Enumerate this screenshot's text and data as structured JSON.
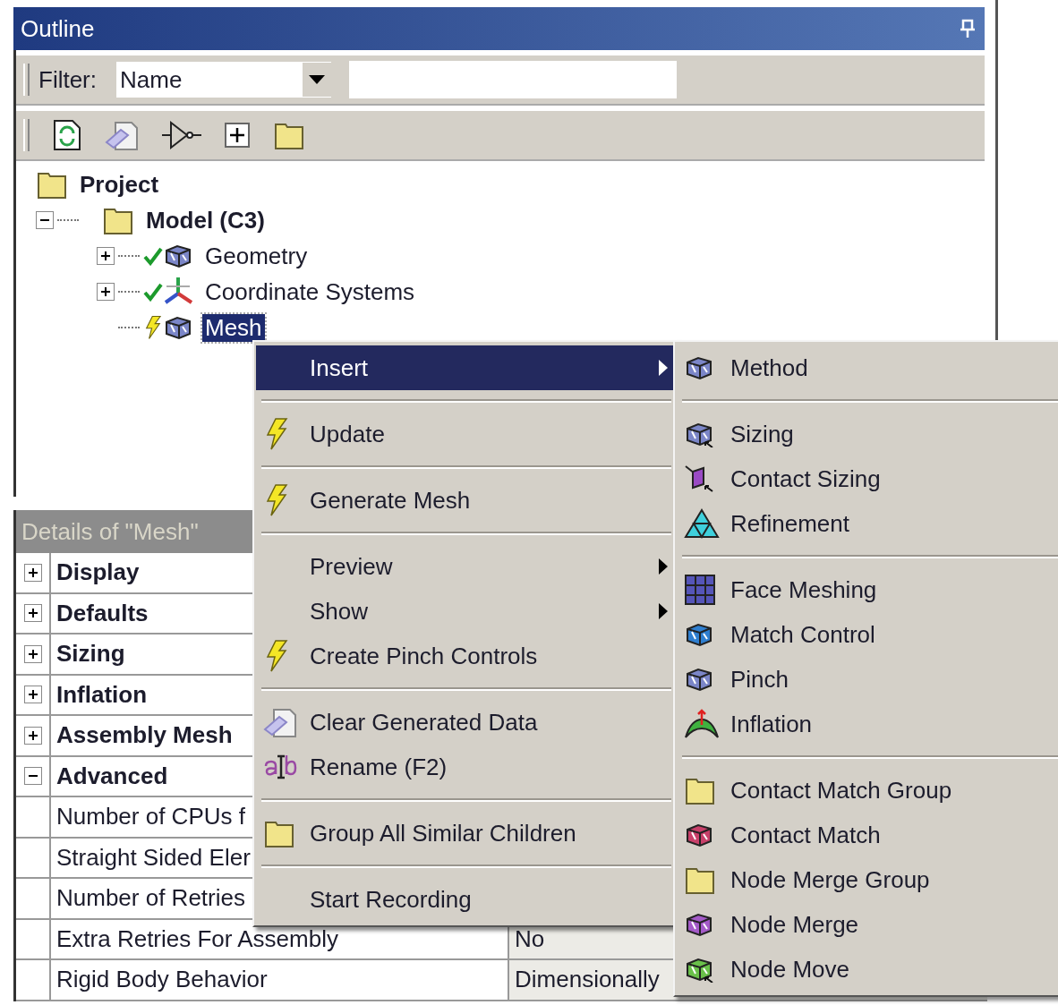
{
  "outline": {
    "title": "Outline",
    "filter": {
      "label": "Filter:",
      "value": "Name"
    },
    "tree": [
      {
        "label": "Project",
        "bold": true,
        "selected": false,
        "children": [
          {
            "label": "Model (C3)",
            "bold": true,
            "selected": false,
            "expanded": true,
            "children": [
              {
                "label": "Geometry",
                "bold": false,
                "selected": false,
                "expanded": false,
                "outdated": false
              },
              {
                "label": "Coordinate Systems",
                "bold": false,
                "selected": false,
                "expanded": false,
                "outdated": false
              },
              {
                "label": "Mesh",
                "bold": false,
                "selected": true,
                "outdated": true
              }
            ]
          }
        ]
      }
    ]
  },
  "details": {
    "title": "Details of \"Mesh\"",
    "groups": [
      {
        "label": "Display",
        "expanded": false
      },
      {
        "label": "Defaults",
        "expanded": false
      },
      {
        "label": "Sizing",
        "expanded": false
      },
      {
        "label": "Inflation",
        "expanded": false
      },
      {
        "label": "Assembly Mesh",
        "expanded": false
      },
      {
        "label": "Advanced",
        "expanded": true,
        "children": [
          {
            "name": "Number of CPUs f"
          },
          {
            "name": "Straight Sided Eler"
          },
          {
            "name": "Number of Retries"
          },
          {
            "name": "Extra Retries For Assembly",
            "value": "No"
          },
          {
            "name": "Rigid Body Behavior",
            "value": "Dimensionally"
          }
        ]
      }
    ]
  },
  "context_menu": {
    "sections": [
      [
        {
          "label": "Insert",
          "submenu": true,
          "selected": true
        }
      ],
      [
        {
          "label": "Update",
          "submenu": false,
          "selected": false
        }
      ],
      [
        {
          "label": "Generate Mesh",
          "submenu": false,
          "selected": false
        }
      ],
      [
        {
          "label": "Preview",
          "submenu": true,
          "selected": false
        },
        {
          "label": "Show",
          "submenu": true,
          "selected": false
        },
        {
          "label": "Create Pinch Controls",
          "submenu": false,
          "selected": false
        }
      ],
      [
        {
          "label": "Clear Generated Data",
          "submenu": false,
          "selected": false
        },
        {
          "label": "Rename (F2)",
          "submenu": false,
          "selected": false
        }
      ],
      [
        {
          "label": "Group All Similar Children",
          "submenu": false,
          "selected": false
        }
      ],
      [
        {
          "label": "Start Recording",
          "submenu": false,
          "selected": false
        }
      ]
    ]
  },
  "insert_submenu": {
    "sections": [
      [
        "Method"
      ],
      [
        "Sizing",
        "Contact Sizing",
        "Refinement"
      ],
      [
        "Face Meshing",
        "Match Control",
        "Pinch",
        "Inflation"
      ],
      [
        "Contact Match Group",
        "Contact Match",
        "Node Merge Group",
        "Node Merge",
        "Node Move"
      ]
    ]
  }
}
